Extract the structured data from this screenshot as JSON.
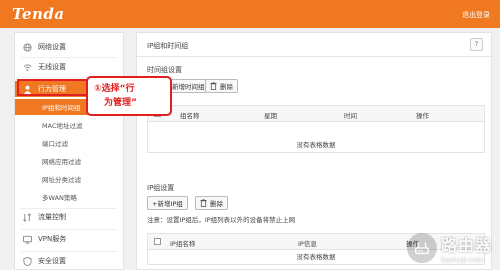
{
  "header": {
    "logo": "Tenda",
    "logout": "退出登录"
  },
  "sidebar": {
    "items": [
      {
        "label": "网络设置",
        "icon": "globe-icon"
      },
      {
        "label": "无线设置",
        "icon": "wifi-icon"
      },
      {
        "label": "行为管理",
        "icon": "user-icon"
      },
      {
        "label": "流量控制",
        "icon": "traffic-icon"
      },
      {
        "label": "VPN服务",
        "icon": "vpn-icon"
      },
      {
        "label": "安全设置",
        "icon": "shield-icon"
      }
    ],
    "sub_items": [
      "IP组和时间组",
      "MAC地址过滤",
      "端口过滤",
      "网络应用过滤",
      "网址分类过滤",
      "多WAN策略"
    ]
  },
  "main": {
    "title": "IP组和时间组",
    "help": "?",
    "time_group": {
      "section_title": "时间组设置",
      "add_label": "新增时间组",
      "delete_label": "删除",
      "columns": [
        "组名称",
        "星期",
        "时间",
        "操作"
      ],
      "empty": "没有表格数据"
    },
    "ip_group": {
      "section_title": "IP组设置",
      "add_label": "+新增IP组",
      "delete_label": "删除",
      "note": "注意：设置IP组后，IP组列表以外的设备将禁止上网",
      "columns": [
        "IP组名称",
        "IP信息",
        "操作"
      ],
      "empty": "没有表格数据"
    }
  },
  "annotation": {
    "line1": "①选择“行",
    "line2": "为管理”"
  },
  "watermark": {
    "main": "路由器",
    "url": "luyouqi.com"
  },
  "colors": {
    "brand": "#f07820",
    "callout": "#e02020"
  }
}
